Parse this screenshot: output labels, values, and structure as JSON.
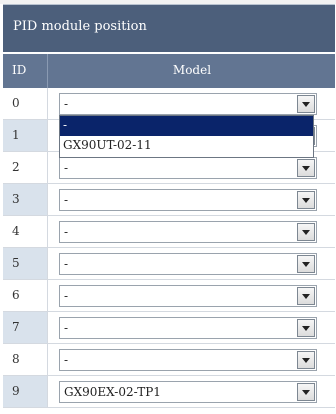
{
  "panel": {
    "title": "PID module position"
  },
  "table": {
    "header_id": "ID",
    "header_model": "Model",
    "rows": [
      {
        "id": "0",
        "model": "-"
      },
      {
        "id": "1",
        "model": "-"
      },
      {
        "id": "2",
        "model": "-"
      },
      {
        "id": "3",
        "model": "-"
      },
      {
        "id": "4",
        "model": "-"
      },
      {
        "id": "5",
        "model": "-"
      },
      {
        "id": "6",
        "model": "-"
      },
      {
        "id": "7",
        "model": "-"
      },
      {
        "id": "8",
        "model": "-"
      },
      {
        "id": "9",
        "model": "GX90EX-02-TP1"
      }
    ]
  },
  "dropdown_open": {
    "row_id": "1",
    "options": [
      "-",
      "GX90UT-02-11"
    ],
    "highlighted_index": 0
  },
  "icons": {
    "select_arrow": "chevron-down-icon"
  },
  "colors": {
    "title_bar": "#4c5f7b",
    "header_row": "#627592",
    "alt_row_id": "#d9e2ec",
    "selection": "#0a246a"
  }
}
